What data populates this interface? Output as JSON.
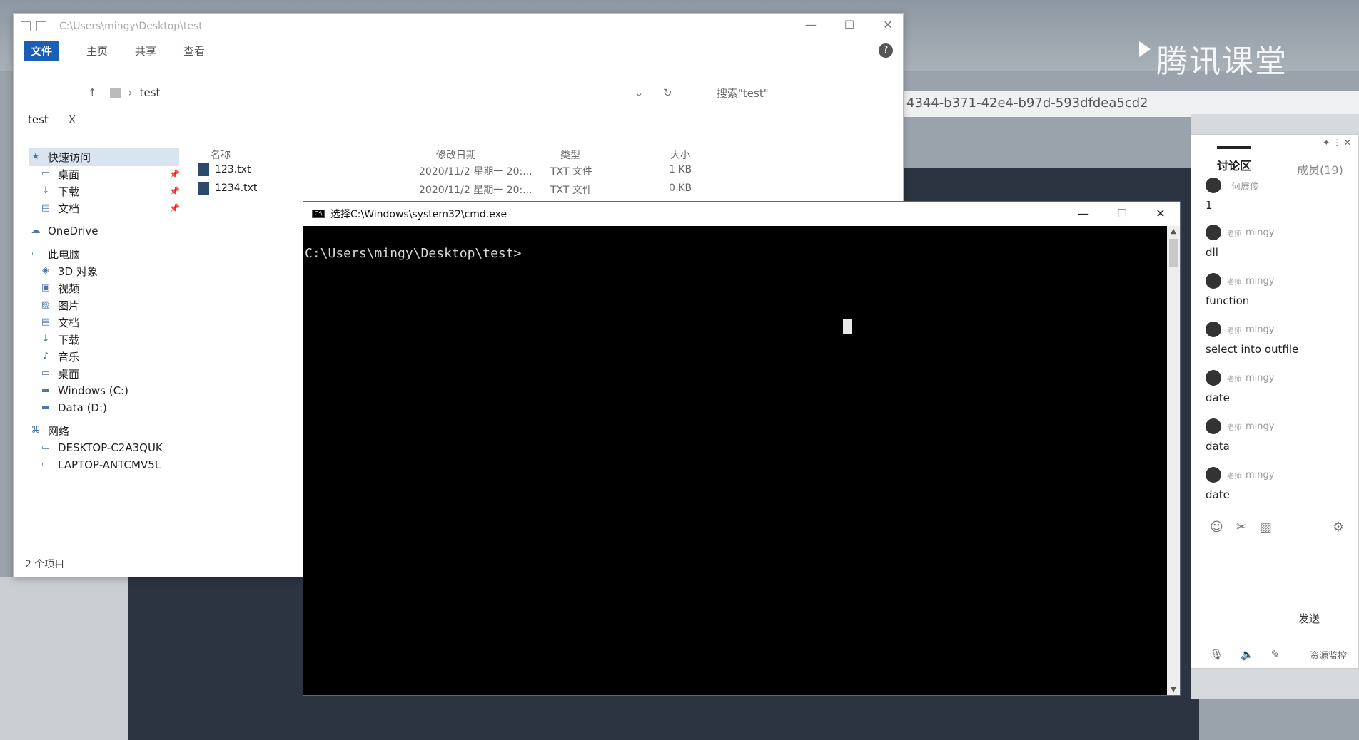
{
  "background": {
    "brand": "腾讯课堂",
    "url_fragment": "4344-b371-42e4-b97d-593dfdea5cd2"
  },
  "explorer": {
    "title_path": "C:\\Users\\mingy\\Desktop\\test",
    "ribbon": {
      "file": "文件",
      "home": "主页",
      "share": "共享",
      "view": "查看"
    },
    "address": {
      "location": "test",
      "search_placeholder": "搜索\"test\""
    },
    "tab": {
      "label": "test",
      "close": "X"
    },
    "nav": {
      "quick_access": "快速访问",
      "qa_desktop": "桌面",
      "qa_downloads": "下载",
      "qa_documents": "文档",
      "onedrive": "OneDrive",
      "this_pc": "此电脑",
      "objects3d": "3D 对象",
      "videos": "视频",
      "pictures": "图片",
      "documents": "文档",
      "downloads": "下载",
      "music": "音乐",
      "desktop": "桌面",
      "drive_c": "Windows (C:)",
      "drive_d": "Data (D:)",
      "network": "网络",
      "net1": "DESKTOP-C2A3QUK",
      "net2": "LAPTOP-ANTCMV5L"
    },
    "columns": {
      "name": "名称",
      "date": "修改日期",
      "type": "类型",
      "size": "大小"
    },
    "files": [
      {
        "name": "123.txt",
        "date": "2020/11/2 星期一 20:...",
        "type": "TXT 文件",
        "size": "1 KB"
      },
      {
        "name": "1234.txt",
        "date": "2020/11/2 星期一 20:...",
        "type": "TXT 文件",
        "size": "0 KB"
      }
    ],
    "status": "2 个项目"
  },
  "cmd": {
    "title": "选择C:\\Windows\\system32\\cmd.exe",
    "prompt": "C:\\Users\\mingy\\Desktop\\test>"
  },
  "chat": {
    "tab_discussion": "讨论区",
    "tab_members": "成员(19)",
    "messages": [
      {
        "user": "何展俊",
        "role": "",
        "text": "1"
      },
      {
        "user": "mingy",
        "role": "老师",
        "text": "dll"
      },
      {
        "user": "mingy",
        "role": "老师",
        "text": "function"
      },
      {
        "user": "mingy",
        "role": "老师",
        "text": "select into outfile"
      },
      {
        "user": "mingy",
        "role": "老师",
        "text": "date"
      },
      {
        "user": "mingy",
        "role": "老师",
        "text": "data"
      },
      {
        "user": "mingy",
        "role": "老师",
        "text": "date"
      }
    ],
    "send": "发送",
    "resource_monitor": "资源监控"
  },
  "colors": {
    "cmd_bg": "#000000",
    "explorer_accent": "#1a5fb4"
  }
}
